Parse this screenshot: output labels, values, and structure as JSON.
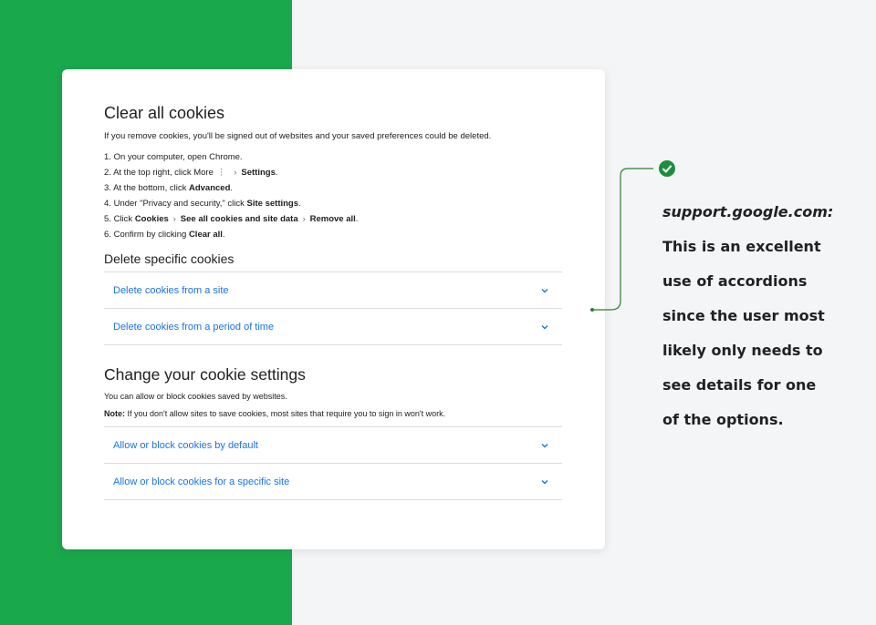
{
  "section1": {
    "title": "Clear all cookies",
    "intro": "If you remove cookies, you'll be signed out of websites and your saved preferences could be deleted.",
    "steps": [
      {
        "num": "1.",
        "text": "On your computer, open Chrome."
      },
      {
        "num": "2.",
        "pre": "At the top right, click More",
        "bold": "Settings",
        "post": "."
      },
      {
        "num": "3.",
        "pre": "At the bottom, click ",
        "bold": "Advanced",
        "post": "."
      },
      {
        "num": "4.",
        "pre": "Under \"Privacy and security,\" click ",
        "bold": "Site settings",
        "post": "."
      },
      {
        "num": "5.",
        "pre": "Click ",
        "bold1": "Cookies",
        "bold2": "See all cookies and site data",
        "bold3": "Remove all",
        "post": "."
      },
      {
        "num": "6.",
        "pre": "Confirm by clicking ",
        "bold": "Clear all",
        "post": "."
      }
    ]
  },
  "section2": {
    "title": "Delete specific cookies",
    "items": [
      "Delete cookies from a site",
      "Delete cookies from a period of time"
    ]
  },
  "section3": {
    "title": "Change your cookie settings",
    "desc": "You can allow or block cookies saved by websites.",
    "note_label": "Note:",
    "note_text": " If you don't allow sites to save cookies, most sites that require you to sign in won't work.",
    "items": [
      "Allow or block cookies by default",
      "Allow or block cookies for a specific site"
    ]
  },
  "annotation": {
    "lines": [
      "support.google.com:",
      "This is an excellent",
      "use of accordions",
      "since the user most",
      "likely only needs to",
      "see details for one",
      "of the options."
    ]
  },
  "colors": {
    "green": "#1aa84c",
    "link": "#1a73e8",
    "check": "#1e8e3e",
    "connector": "#2e7d32"
  }
}
